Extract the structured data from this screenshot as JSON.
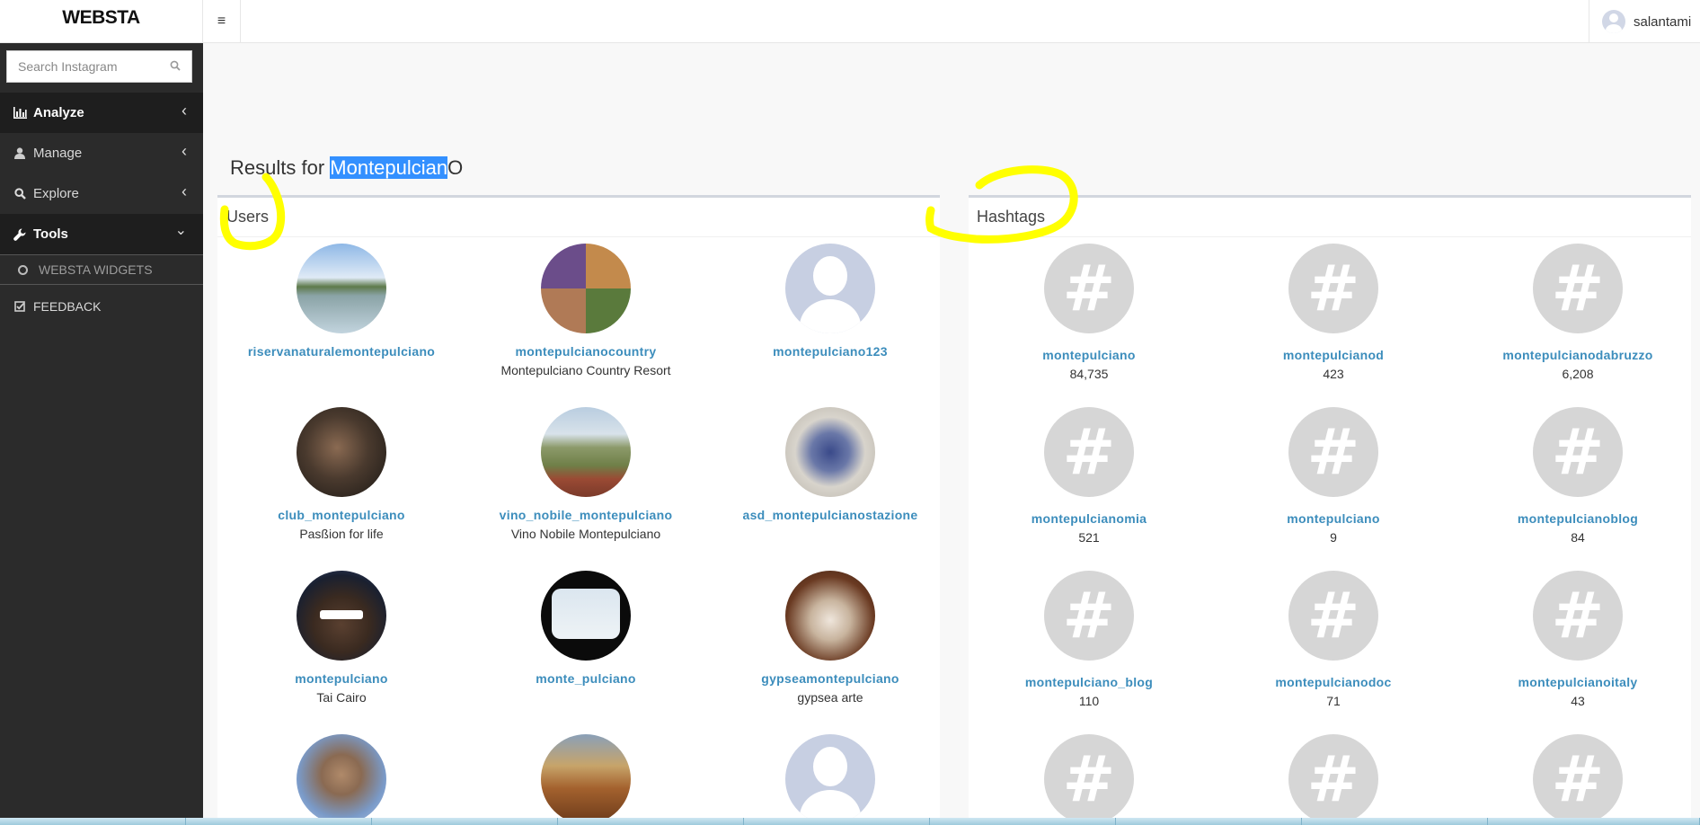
{
  "header": {
    "logo": "WEBSTA",
    "menu_toggle_glyph": "≡",
    "username": "salantami"
  },
  "sidebar": {
    "search_placeholder": "Search Instagram",
    "items": [
      {
        "label": "Analyze",
        "icon": "bar-chart-icon",
        "chevron": "‹"
      },
      {
        "label": "Manage",
        "icon": "user-icon",
        "chevron": "‹"
      },
      {
        "label": "Explore",
        "icon": "search-icon",
        "chevron": "‹"
      },
      {
        "label": "Tools",
        "icon": "wrench-icon",
        "chevron": "⌄"
      }
    ],
    "sub_items": [
      {
        "label": "WEBSTA WIDGETS",
        "icon": "circle-icon"
      }
    ],
    "feedback": {
      "label": "FEEDBACK",
      "icon": "check-square-icon"
    }
  },
  "results": {
    "prefix": "Results for ",
    "query_highlighted": "Montepulcian",
    "query_rest": "O"
  },
  "users_panel": {
    "title": "Users",
    "users": [
      {
        "username": "riservanaturalemontepulciano",
        "fullname": ""
      },
      {
        "username": "montepulcianocountry",
        "fullname": "Montepulciano Country Resort"
      },
      {
        "username": "montepulciano123",
        "fullname": ""
      },
      {
        "username": "club_montepulciano",
        "fullname": "Pasßion for life"
      },
      {
        "username": "vino_nobile_montepulciano",
        "fullname": "Vino Nobile Montepulciano"
      },
      {
        "username": "asd_montepulcianostazione",
        "fullname": ""
      },
      {
        "username": "montepulciano",
        "fullname": "Tai Cairo"
      },
      {
        "username": "monte_pulciano",
        "fullname": ""
      },
      {
        "username": "gypseamontepulciano",
        "fullname": "gypsea arte"
      }
    ]
  },
  "hashtags_panel": {
    "title": "Hashtags",
    "hash_glyph": "#",
    "tags": [
      {
        "name": "montepulciano",
        "count": "84,735"
      },
      {
        "name": "montepulcianod",
        "count": "423"
      },
      {
        "name": "montepulcianodabruzzo",
        "count": "6,208"
      },
      {
        "name": "montepulcianomia",
        "count": "521"
      },
      {
        "name": "montepulciano",
        "count": "9"
      },
      {
        "name": "montepulcianoblog",
        "count": "84"
      },
      {
        "name": "montepulciano_blog",
        "count": "110"
      },
      {
        "name": "montepulcianodoc",
        "count": "71"
      },
      {
        "name": "montepulcianoitaly",
        "count": "43"
      }
    ]
  },
  "colors": {
    "sidebar_bg": "#2b2b2b",
    "link_blue": "#3c8dbc",
    "highlight_blue": "#3390ff",
    "annotation_yellow": "#ffff00"
  }
}
